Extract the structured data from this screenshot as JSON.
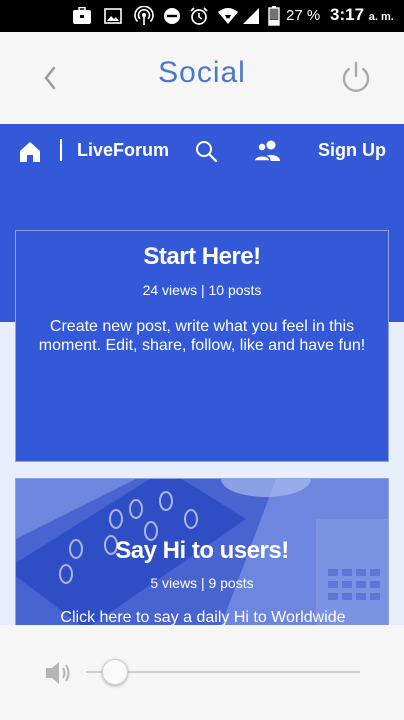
{
  "status_bar": {
    "battery_percent": "27 %",
    "time": "3:17",
    "ampm": "a. m.",
    "icons": [
      "briefcase-icon",
      "image-icon",
      "hotspot-icon",
      "do-not-disturb-icon",
      "alarm-icon",
      "wifi-icon",
      "signal-icon",
      "battery-icon"
    ]
  },
  "app_header": {
    "title": "Social",
    "back_icon": "chevron-left-icon",
    "power_icon": "power-icon"
  },
  "forum_nav": {
    "brand": "LiveForum",
    "signup": "Sign Up",
    "icons": [
      "home-icon",
      "search-icon",
      "users-icon"
    ]
  },
  "cards": [
    {
      "title": "Start Here!",
      "meta": "24 views | 10 posts",
      "description": "Create new post, write what you feel in this moment. Edit, share, follow, like and have fun!"
    },
    {
      "title": "Say Hi to users!",
      "meta": "5 views | 9 posts",
      "description": "Click here to say a daily Hi to Worldwide"
    }
  ],
  "media": {
    "volume_icon": "volume-icon",
    "volume_level": 0.1
  },
  "colors": {
    "primary": "#3359d8",
    "header_title": "#4a78c7",
    "page_bg": "#e9eefc"
  }
}
